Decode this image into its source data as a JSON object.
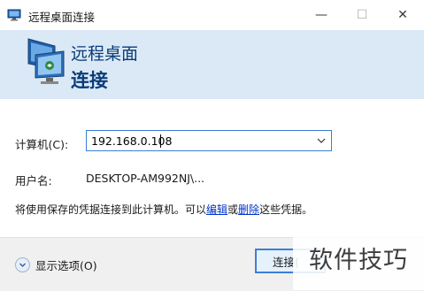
{
  "window": {
    "title": "远程桌面连接",
    "controls": {
      "minimize": "—",
      "maximize": "☐",
      "close": "✕"
    }
  },
  "header": {
    "line1": "远程桌面",
    "line2": "连接"
  },
  "form": {
    "computer_label": "计算机(C):",
    "computer_value": "192.168.0.108",
    "username_label": "用户名:",
    "username_value": "DESKTOP-AM992NJ\\..."
  },
  "notice": {
    "prefix": "将使用保存的凭据连接到此计算机。可以",
    "edit_link": "编辑",
    "middle": "或",
    "delete_link": "删除",
    "suffix": "这些凭据。"
  },
  "footer": {
    "options_label": "显示选项(O)",
    "connect_label": "连接("
  },
  "watermark": "软件技巧",
  "colors": {
    "header_bg": "#dbe9f6",
    "accent": "#3c7fd6",
    "link": "#0033cc",
    "footer_bg": "#f0f0f0"
  },
  "icons": {
    "app": "remote-desktop-icon",
    "logo": "remote-desktop-logo",
    "dropdown": "chevron-down-icon",
    "options": "chevron-down-circle-icon"
  }
}
